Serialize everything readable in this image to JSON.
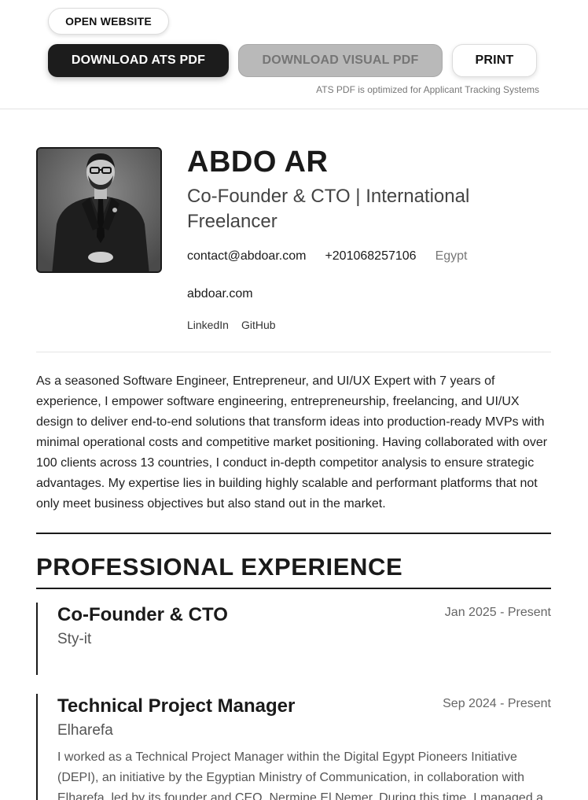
{
  "toolbar": {
    "open_website": "OPEN WEBSITE",
    "download_ats": "DOWNLOAD ATS PDF",
    "download_visual": "DOWNLOAD VISUAL PDF",
    "print": "PRINT",
    "ats_note": "ATS PDF is optimized for Applicant Tracking Systems"
  },
  "profile": {
    "name": "ABDO AR",
    "headline": "Co-Founder & CTO | International Freelancer",
    "email": "contact@abdoar.com",
    "phone": "+201068257106",
    "location": "Egypt",
    "website": "abdoar.com",
    "links": [
      "LinkedIn",
      "GitHub"
    ]
  },
  "summary": "As a seasoned Software Engineer, Entrepreneur, and UI/UX Expert with 7 years of experience, I empower software engineering, entrepreneurship, freelancing, and UI/UX design to deliver end-to-end solutions that transform ideas into production-ready MVPs with minimal operational costs and competitive market positioning. Having collaborated with over 100 clients across 13 countries, I conduct in-depth competitor analysis to ensure strategic advantages. My expertise lies in building highly scalable and performant platforms that not only meet business objectives but also stand out in the market.",
  "experience": {
    "title": "PROFESSIONAL EXPERIENCE",
    "jobs": [
      {
        "title": "Co-Founder & CTO",
        "company": "Sty-it",
        "dates": "Jan 2025 - Present",
        "description": ""
      },
      {
        "title": "Technical Project Manager",
        "company": "Elharefa",
        "dates": "Sep 2024 - Present",
        "description": "I worked as a Technical Project Manager within the Digital Egypt Pioneers Initiative (DEPI), an initiative by the Egyptian Ministry of Communication, in collaboration with Elharefa, led by its founder and CEO, Nermine El Nemer. During this time, I managed a"
      }
    ]
  },
  "colors": {
    "primary_button": "#1c1c1c",
    "disabled_button": "#b9b9b9",
    "text": "#1a1a1a",
    "muted": "#777777"
  }
}
